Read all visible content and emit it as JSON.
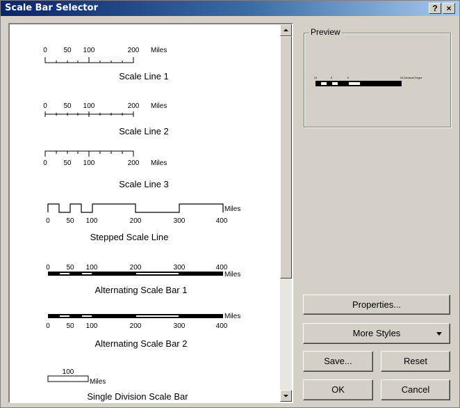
{
  "window": {
    "title": "Scale Bar Selector"
  },
  "titlebar_buttons": {
    "help": "?",
    "close": "×"
  },
  "styles": [
    {
      "name": "Scale Line 1",
      "ticks": [
        "0",
        "50",
        "100",
        "200"
      ],
      "units": "Miles"
    },
    {
      "name": "Scale Line 2",
      "ticks": [
        "0",
        "50",
        "100",
        "200"
      ],
      "units": "Miles"
    },
    {
      "name": "Scale Line 3",
      "ticks": [
        "0",
        "50",
        "100",
        "200"
      ],
      "units": "Miles"
    },
    {
      "name": "Stepped Scale Line",
      "ticks": [
        "0",
        "50",
        "100",
        "200",
        "300",
        "400"
      ],
      "units": "Miles"
    },
    {
      "name": "Alternating Scale Bar 1",
      "ticks": [
        "0",
        "50",
        "100",
        "200",
        "300",
        "400"
      ],
      "units": "Miles"
    },
    {
      "name": "Alternating Scale Bar 2",
      "ticks": [
        "0",
        "50",
        "100",
        "200",
        "300",
        "400"
      ],
      "units": "Miles"
    },
    {
      "name": "Single Division Scale Bar",
      "ticks": [
        "100"
      ],
      "units": "Miles"
    }
  ],
  "preview": {
    "label": "Preview",
    "ticks": [
      "10",
      "5",
      "0",
      "10"
    ],
    "units": "Decimal Degre"
  },
  "buttons": {
    "properties": "Properties...",
    "more_styles": "More Styles",
    "save": "Save...",
    "reset": "Reset",
    "ok": "OK",
    "cancel": "Cancel"
  }
}
